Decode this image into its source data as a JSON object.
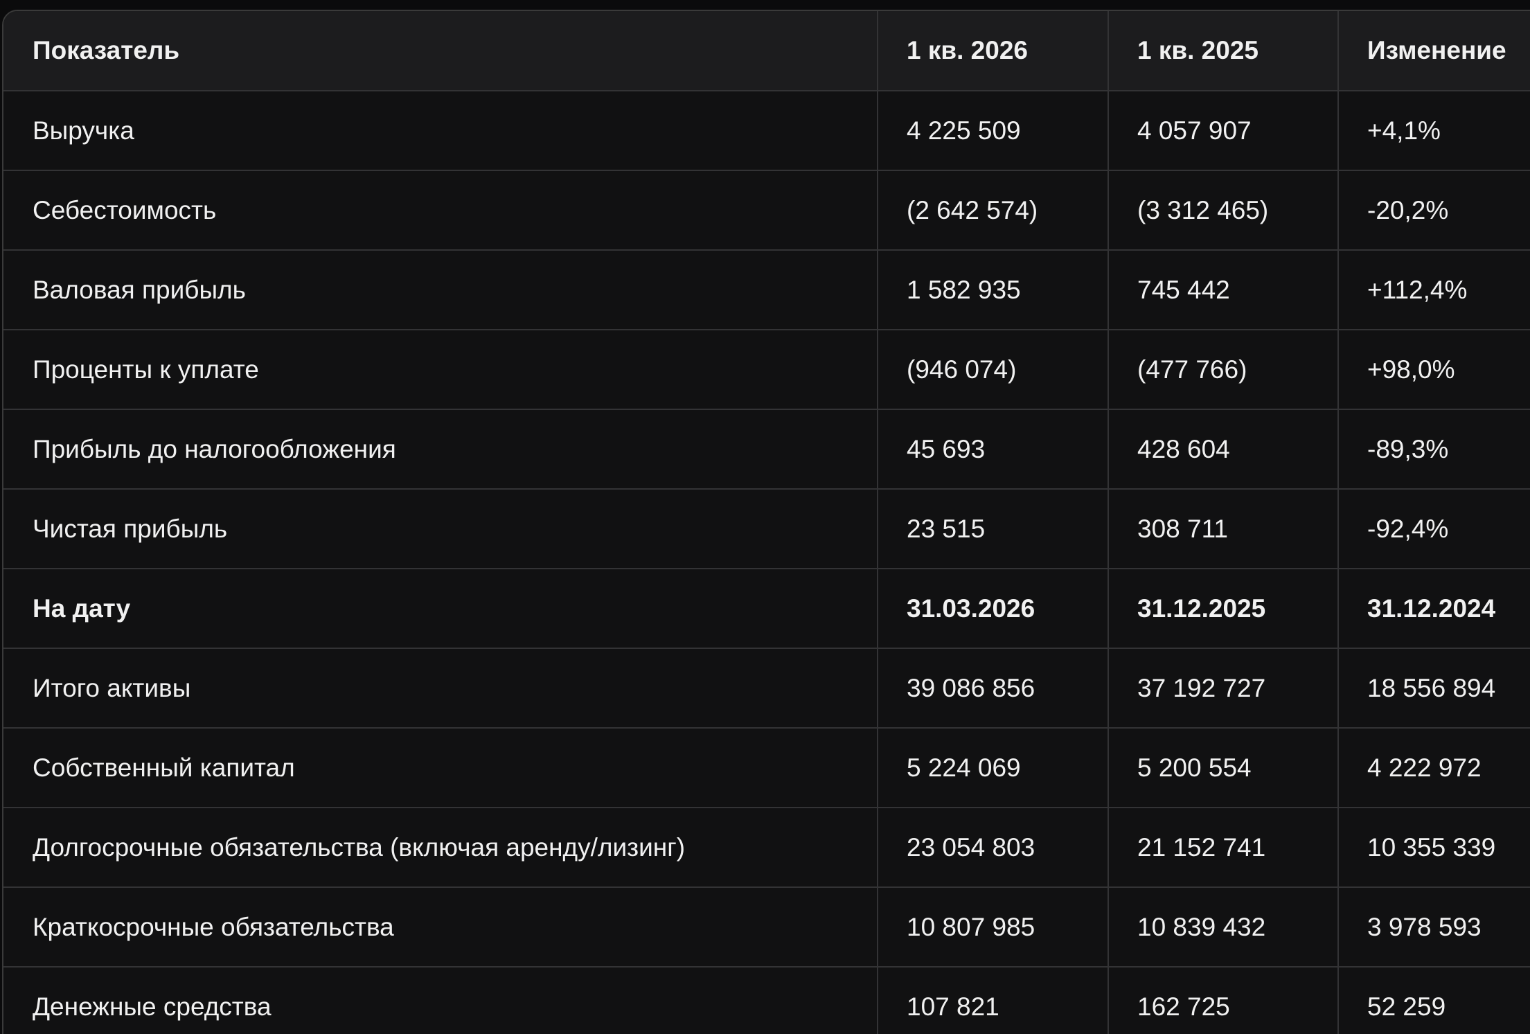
{
  "table": {
    "headers": [
      "Показатель",
      "1 кв. 2026",
      "1 кв. 2025",
      "Изменение"
    ],
    "rows": [
      {
        "cells": [
          "Выручка",
          "4 225 509",
          "4 057 907",
          "+4,1%"
        ]
      },
      {
        "cells": [
          "Себестоимость",
          "(2 642 574)",
          "(3 312 465)",
          "-20,2%"
        ]
      },
      {
        "cells": [
          "Валовая прибыль",
          "1 582 935",
          "745 442",
          "+112,4%"
        ]
      },
      {
        "cells": [
          "Проценты к уплате",
          "(946 074)",
          "(477 766)",
          "+98,0%"
        ]
      },
      {
        "cells": [
          "Прибыль до налогообложения",
          "45 693",
          "428 604",
          "-89,3%"
        ]
      },
      {
        "cells": [
          "Чистая прибыль",
          "23 515",
          "308 711",
          "-92,4%"
        ]
      },
      {
        "cells": [
          "На дату",
          "31.03.2026",
          "31.12.2025",
          "31.12.2024"
        ],
        "bold": true
      },
      {
        "cells": [
          "Итого активы",
          "39 086 856",
          "37 192 727",
          "18 556 894"
        ]
      },
      {
        "cells": [
          "Собственный капитал",
          "5 224 069",
          "5 200 554",
          "4 222 972"
        ]
      },
      {
        "cells": [
          "Долгосрочные обязательства (включая аренду/лизинг)",
          "23 054 803",
          "21 152 741",
          "10 355 339"
        ]
      },
      {
        "cells": [
          "Краткосрочные обязательства",
          "10 807 985",
          "10 839 432",
          "3 978 593"
        ]
      },
      {
        "cells": [
          "Денежные средства",
          "107 821",
          "162 725",
          "52 259"
        ]
      }
    ]
  }
}
